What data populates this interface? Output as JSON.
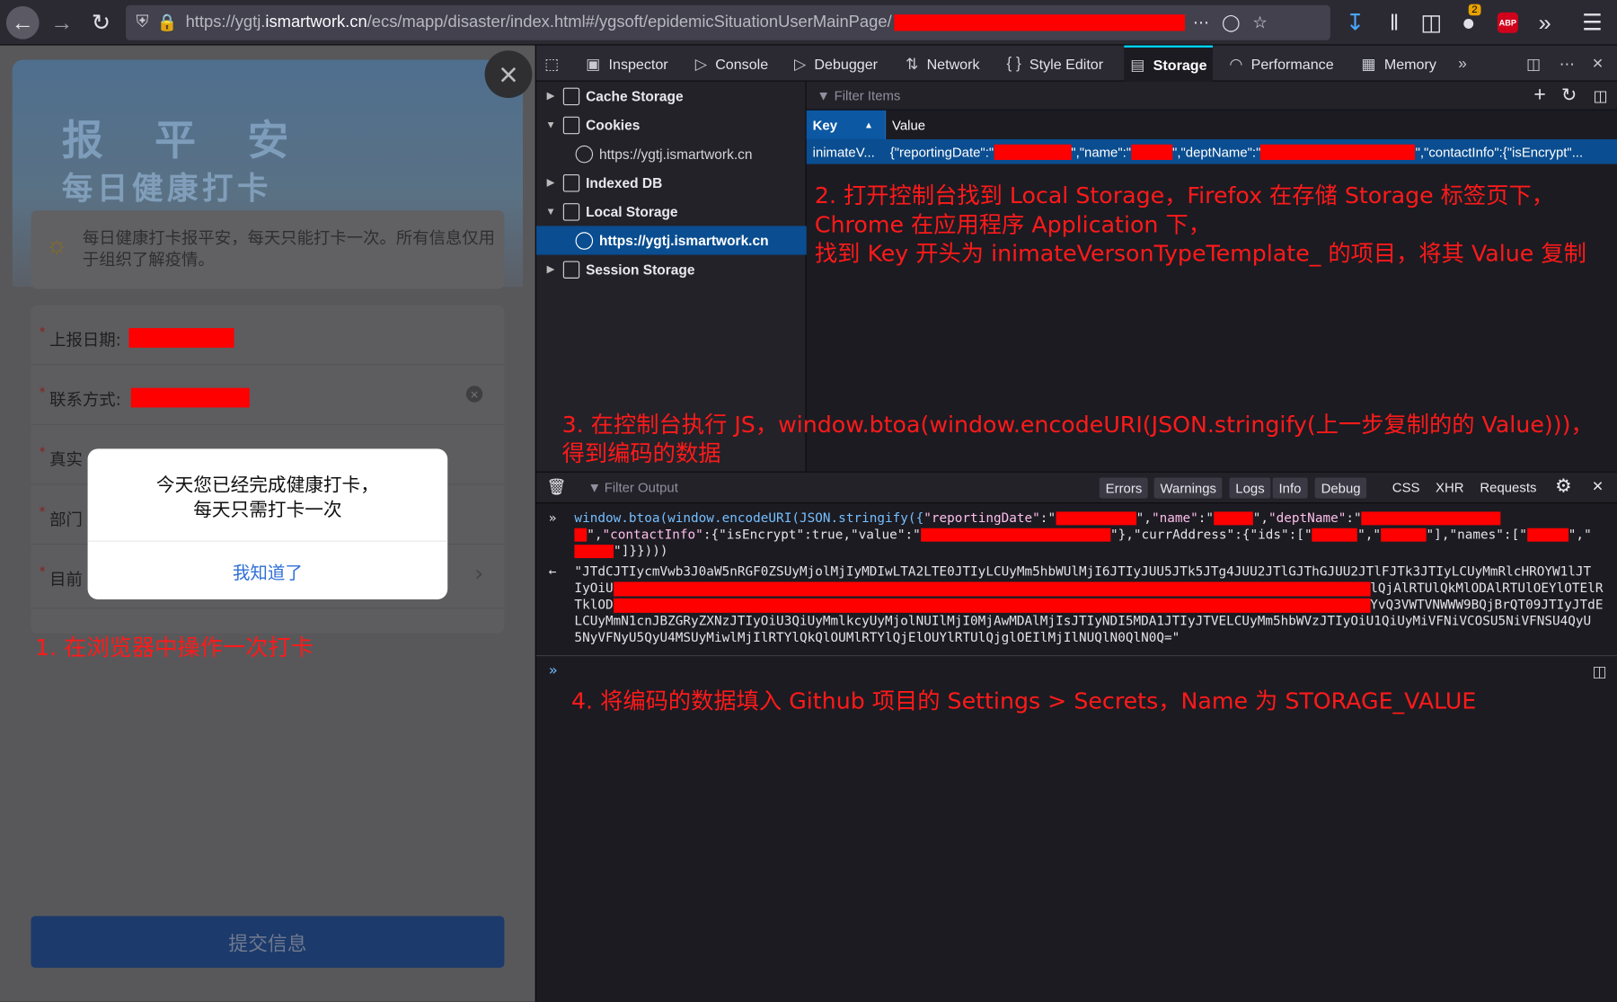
{
  "browser": {
    "url_prefix": "https://ygtj.",
    "url_host": "ismartwork.cn",
    "url_path": "/ecs/mapp/disaster/index.html#/ygsoft/epidemicSituationUserMainPage/",
    "badge_count": "2",
    "abp_label": "ABP"
  },
  "page": {
    "banner_title": "报 平 安",
    "banner_sub": "每日健康打卡",
    "notice": "每日健康打卡报平安，每天只能打卡一次。所有信息仅用于组织了解疫情。",
    "fields": {
      "date": "上报日期:",
      "contact": "联系方式:",
      "name_trunc": "真实",
      "dept_trunc": "部门",
      "current_trunc": "目前"
    },
    "submit": "提交信息",
    "modal_message": "今天您已经完成健康打卡，\n每天只需打卡一次",
    "modal_button": "我知道了"
  },
  "annotations": {
    "step1": "1. 在浏览器中操作一次打卡",
    "step2_l1": "2. 打开控制台找到 Local Storage，Firefox 在存储 Storage 标签页下，",
    "step2_l2": "Chrome 在应用程序 Application 下，",
    "step2_l3": "找到 Key 开头为 inimateVersonTypeTemplate_ 的项目，将其 Value 复制",
    "step3_l1": "3. 在控制台执行 JS，window.btoa(window.encodeURI(JSON.stringify(上一步复制的的 Value)))，",
    "step3_l2": "得到编码的数据",
    "step4": "4. 将编码的数据填入 Github 项目的 Settings > Secrets，Name 为 STORAGE_VALUE"
  },
  "devtools": {
    "tabs": [
      "Inspector",
      "Console",
      "Debugger",
      "Network",
      "Style Editor",
      "Storage",
      "Performance",
      "Memory"
    ],
    "tree": {
      "cache": "Cache Storage",
      "cookies": "Cookies",
      "cookies_host": "https://ygtj.ismartwork.cn",
      "indexed": "Indexed DB",
      "local": "Local Storage",
      "local_host": "https://ygtj.ismartwork.cn",
      "session": "Session Storage"
    },
    "filter_items": "Filter Items",
    "col_key": "Key",
    "col_value": "Value",
    "row_key": "inimateV...",
    "row_value_parts": [
      "{\"reportingDate\":\"",
      "\",\"name\":\"",
      "\",\"deptName\":\"",
      "\",\"contactInfo\":{\"isEncrypt\"..."
    ],
    "filter_output": "Filter Output",
    "levels": [
      "Errors",
      "Warnings",
      "Logs",
      "Info",
      "Debug"
    ],
    "extra_filters": [
      "CSS",
      "XHR",
      "Requests"
    ],
    "cmd": {
      "fn": "window.btoa(window.encodeURI(JSON.stringify({",
      "k1": "\"reportingDate\"",
      "k2": "\"name\"",
      "k3": "\"deptName\"",
      "line2a": "\",",
      "k4": "\"contactInfo\"",
      "line2b": ":{\"isEncrypt\":true,\"value\":\"",
      "line2c": "\"},\"currAddress\":{\"ids\":[\"",
      "line2d": "\"],\"names\":[\"",
      "line3": "\"]}})))"
    },
    "result": {
      "l1": "\"JTdCJTIycmVwb3J0aW5nRGF0ZSUyMjolMjIyMDIwLTA2LTE0JTIyLCUyMm5hbWUlMjI6JTIyJUU5JTk5JTg4JUU2JTlGJThGJUU2JTlFJTk3JTIyLCUyMmRlcHROYW1lJT",
      "l2a": "IyOiU",
      "l2b": "lQjAlRTUlQkMlODAlRTUlOEYlOTElR",
      "l3a": "TklOD",
      "l3b": "YvQ3VWTVNWWW9BQjBrQT09JTIyJTdE",
      "l4": "LCUyMmN1cnJBZGRyZXNzJTIyOiU3QiUyMmlkcyUyMjolNUIlMjI0MjAwMDAlMjIsJTIyNDI5MDA1JTIyJTVELCUyMm5hbWVzJTIyOiU1QiUyMiVFNiVCOSU5NiVFNSU4QyU",
      "l5": "5NyVFNyU5QyU4MSUyMiwlMjIlRTYlQkQlOUMlRTYlQjElOUYlRTUlQjglOEIlMjIlNUQlN0QlN0Q=\""
    }
  }
}
